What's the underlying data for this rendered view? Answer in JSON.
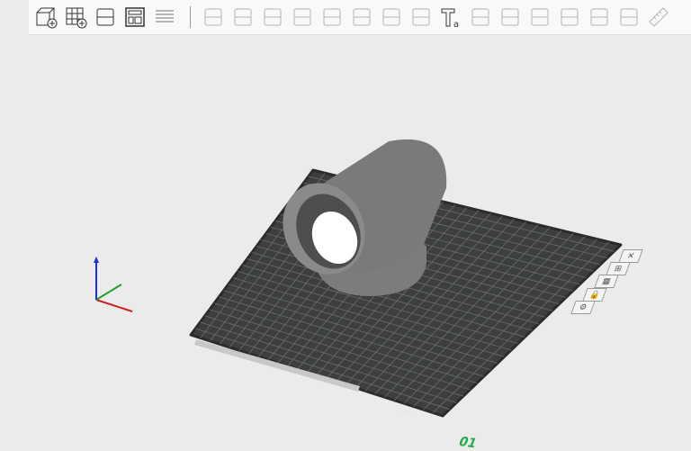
{
  "toolbar": {
    "items": [
      {
        "icon": "add-object-icon",
        "enabled": true
      },
      {
        "icon": "add-plate-icon",
        "enabled": true
      },
      {
        "icon": "auto-orient-icon",
        "enabled": true
      },
      {
        "icon": "arrange-icon",
        "enabled": true
      },
      {
        "icon": "layers-icon",
        "enabled": false
      },
      {
        "icon": "move-icon",
        "enabled": false
      },
      {
        "icon": "rotate-icon",
        "enabled": false
      },
      {
        "icon": "scale-icon",
        "enabled": false
      },
      {
        "icon": "lay-on-face-icon",
        "enabled": false
      },
      {
        "icon": "cut-icon",
        "enabled": false
      },
      {
        "icon": "mesh-boolean-icon",
        "enabled": false
      },
      {
        "icon": "support-paint-icon",
        "enabled": false
      },
      {
        "icon": "color-paint-icon",
        "enabled": false
      },
      {
        "icon": "text-icon",
        "enabled": true
      },
      {
        "icon": "seam-paint-icon",
        "enabled": false
      },
      {
        "icon": "split-objects-icon",
        "enabled": false
      },
      {
        "icon": "fit-to-bed-icon",
        "enabled": false
      },
      {
        "icon": "variable-layer-height-icon",
        "enabled": false
      },
      {
        "icon": "split-to-objects-icon",
        "enabled": false
      },
      {
        "icon": "split-to-parts-icon",
        "enabled": false
      },
      {
        "icon": "measure-icon",
        "enabled": false
      }
    ]
  },
  "plate": {
    "number": "01",
    "side_buttons": [
      "close-plate-icon",
      "auto-arrange-plate-icon",
      "orient-plate-icon",
      "lock-plate-icon",
      "plate-settings-icon"
    ]
  },
  "colors": {
    "plate": "#3d3f3f",
    "grid": "#6b6d6d",
    "object": "#7a7a7a",
    "accent": "#1db04a",
    "axis_x": "#d02020",
    "axis_y": "#20a020",
    "axis_z": "#2030d0"
  }
}
